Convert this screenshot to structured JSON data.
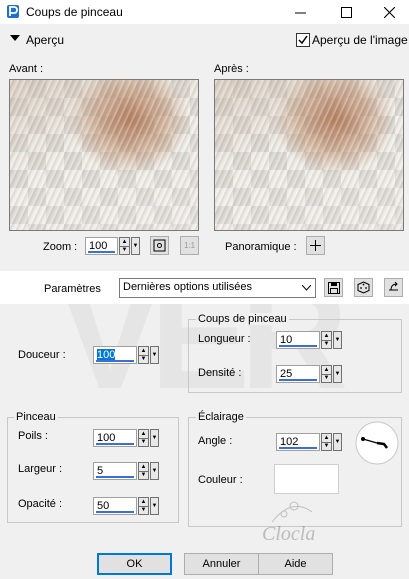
{
  "window": {
    "title": "Coups de pinceau"
  },
  "apercu": {
    "label": "Aperçu",
    "image_preview_label": "Aperçu de l'image",
    "image_preview_checked": true
  },
  "preview": {
    "before_label": "Avant :",
    "after_label": "Après :"
  },
  "zoom": {
    "label": "Zoom :",
    "value": "100",
    "pan_label": "Panoramique :"
  },
  "params": {
    "label": "Paramètres",
    "preset": "Dernières options utilisées"
  },
  "douceur": {
    "label": "Douceur :",
    "value": "100"
  },
  "coups": {
    "title": "Coups de pinceau",
    "longueur_label": "Longueur :",
    "longueur_value": "10",
    "densite_label": "Densité :",
    "densite_value": "25"
  },
  "pinceau": {
    "title": "Pinceau",
    "poils_label": "Poils :",
    "poils_value": "100",
    "largeur_label": "Largeur :",
    "largeur_value": "5",
    "opacite_label": "Opacité :",
    "opacite_value": "50"
  },
  "eclairage": {
    "title": "Éclairage",
    "angle_label": "Angle :",
    "angle_value": "102",
    "couleur_label": "Couleur :",
    "couleur_value": "#ffffff"
  },
  "buttons": {
    "ok": "OK",
    "annuler": "Annuler",
    "aide": "Aide"
  },
  "watermark": {
    "signature": "Clocla"
  },
  "colors": {
    "accent": "#0078d7",
    "underline": "#3a6fd8",
    "preview_brown": "#b27855"
  }
}
